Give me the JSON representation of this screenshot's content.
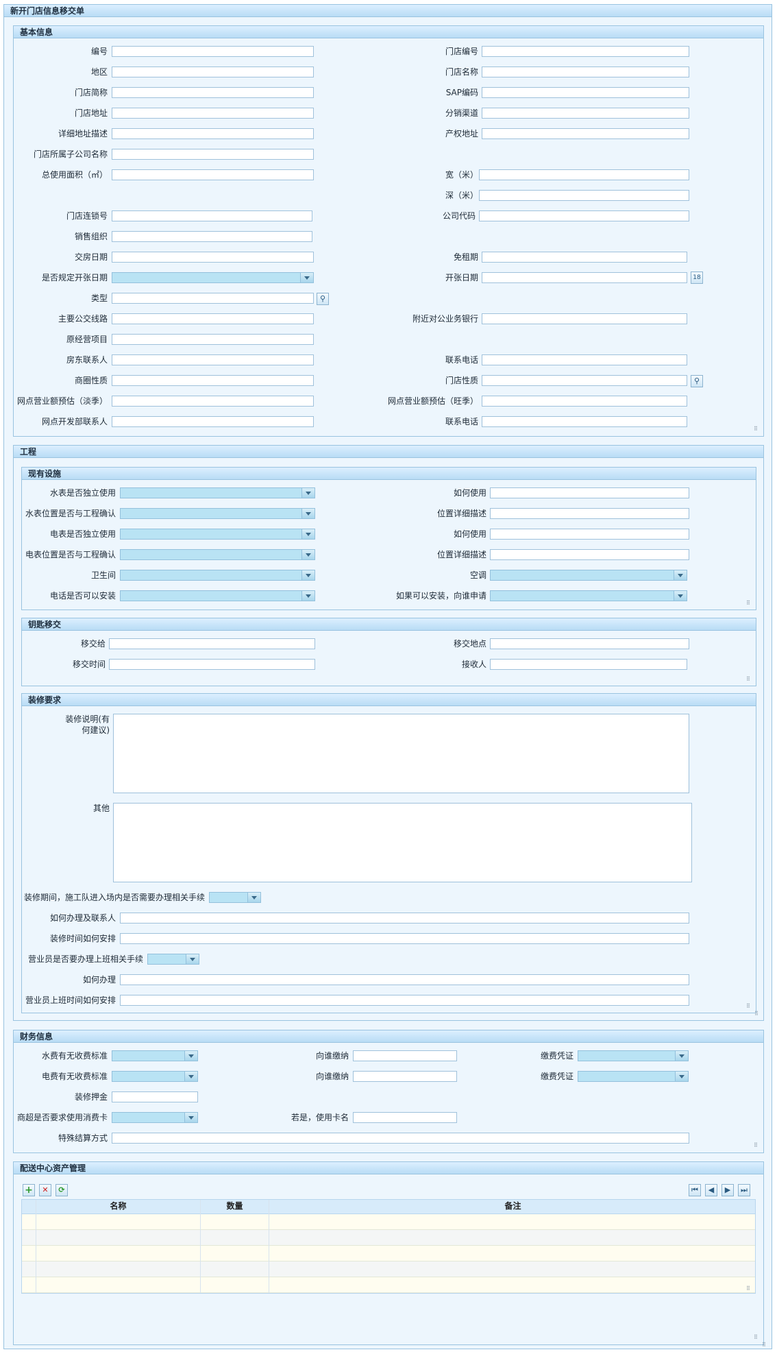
{
  "form_title": "新开门店信息移交单",
  "basic": {
    "title": "基本信息",
    "labels": {
      "no": "编号",
      "store_no": "门店编号",
      "area": "地区",
      "store_name": "门店名称",
      "store_short": "门店简称",
      "sap": "SAP编码",
      "store_addr": "门店地址",
      "channel": "分销渠道",
      "addr_detail": "详细地址描述",
      "property_addr": "产权地址",
      "subsidiary": "门店所属子公司名称",
      "total_area": "总使用面积（㎡）",
      "width": "宽（米）",
      "depth": "深（米）",
      "chain_no": "门店连锁号",
      "company_code": "公司代码",
      "sales_org": "销售组织",
      "handover_date": "交房日期",
      "rent_free": "免租期",
      "fixed_open": "是否规定开张日期",
      "open_date": "开张日期",
      "type": "类型",
      "bus_route": "主要公交线路",
      "bank": "附近对公业务银行",
      "orig_business": "原经营项目",
      "landlord": "房东联系人",
      "phone1": "联系电话",
      "business_circle": "商圈性质",
      "store_nature": "门店性质",
      "rev_low": "网点营业额预估（淡季）",
      "rev_high": "网点营业额预估（旺季）",
      "dev_contact": "网点开发部联系人",
      "phone2": "联系电话"
    }
  },
  "engineering": {
    "title": "工程",
    "facilities": {
      "title": "现有设施",
      "labels": {
        "water_indep": "水表是否独立使用",
        "water_how": "如何使用",
        "water_pos": "水表位置是否与工程确认",
        "water_pos_desc": "位置详细描述",
        "elec_indep": "电表是否独立使用",
        "elec_how": "如何使用",
        "elec_pos": "电表位置是否与工程确认",
        "elec_pos_desc": "位置详细描述",
        "toilet": "卫生间",
        "ac": "空调",
        "phone_install": "电话是否可以安装",
        "phone_apply": "如果可以安装，向谁申请"
      }
    },
    "keys": {
      "title": "钥匙移交",
      "labels": {
        "to": "移交给",
        "place": "移交地点",
        "time": "移交时间",
        "receiver": "接收人"
      }
    },
    "decoration": {
      "title": "装修要求",
      "labels": {
        "desc": "装修说明(有何建议)",
        "other": "其他",
        "permit": "装修期间，施工队进入场内是否需要办理相关手续",
        "how_contact": "如何办理及联系人",
        "schedule": "装修时间如何安排",
        "staff_permit": "营业员是否要办理上班相关手续",
        "how": "如何办理",
        "staff_schedule": "营业员上班时间如何安排"
      }
    }
  },
  "finance": {
    "title": "财务信息",
    "labels": {
      "water_fee": "水费有无收费标准",
      "pay_to1": "向谁缴纳",
      "voucher1": "缴费凭证",
      "elec_fee": "电费有无收费标准",
      "pay_to2": "向谁缴纳",
      "voucher2": "缴费凭证",
      "deposit": "装修押金",
      "card": "商超是否要求使用消费卡",
      "card_name": "若是，使用卡名",
      "settlement": "特殊结算方式"
    }
  },
  "assets": {
    "title": "配送中心资产管理",
    "columns": [
      "名称",
      "数量",
      "备注"
    ],
    "icons": [
      "add-icon",
      "delete-icon",
      "refresh-icon",
      "first-page-icon",
      "prev-page-icon",
      "next-page-icon",
      "last-page-icon"
    ]
  }
}
